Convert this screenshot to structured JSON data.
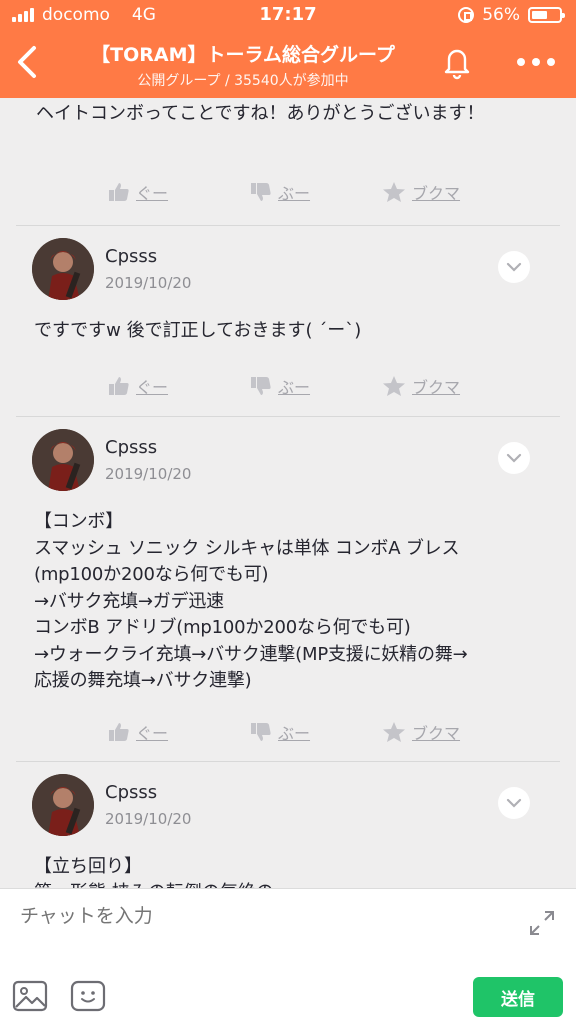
{
  "status_bar": {
    "carrier": "docomo",
    "network": "4G",
    "time": "17:17",
    "battery_percent": "56%",
    "battery_level": 0.56
  },
  "header": {
    "title": "【TORAM】トーラム総合グループ",
    "subtitle": "公開グループ / 35540人が参加中"
  },
  "actions_labels": {
    "good": "ぐー",
    "boo": "ぶー",
    "bookmark": "ブクマ"
  },
  "top_comment": {
    "text": "ヘイトコンボってことですね！ありがとうございます！"
  },
  "posts": [
    {
      "user": "Cpsss",
      "date": "2019/10/20",
      "lines": [
        "ですですw 後で訂正しておきます( ´ー`)"
      ]
    },
    {
      "user": "Cpsss",
      "date": "2019/10/20",
      "lines": [
        "【コンボ】",
        "スマッシュ ソニック シルキャは単体 コンボA ブレス",
        "(mp100か200なら何でも可)",
        "→バサク充填→ガデ迅速",
        "コンボB アドリブ(mp100か200なら何でも可)",
        "→ウォークライ充填→バサク連撃(MP支援に妖精の舞→",
        "応援の舞充填→バサク連撃)"
      ]
    },
    {
      "user": "Cpsss",
      "date": "2019/10/20",
      "lines": [
        "【立ち回り】",
        "第一形態 挟みの転倒の気絶の"
      ]
    }
  ],
  "input_bar": {
    "placeholder": "チャットを入力",
    "send_label": "送信"
  },
  "colors": {
    "header_bg": "#ff7a45",
    "send_bg": "#1fc468"
  }
}
